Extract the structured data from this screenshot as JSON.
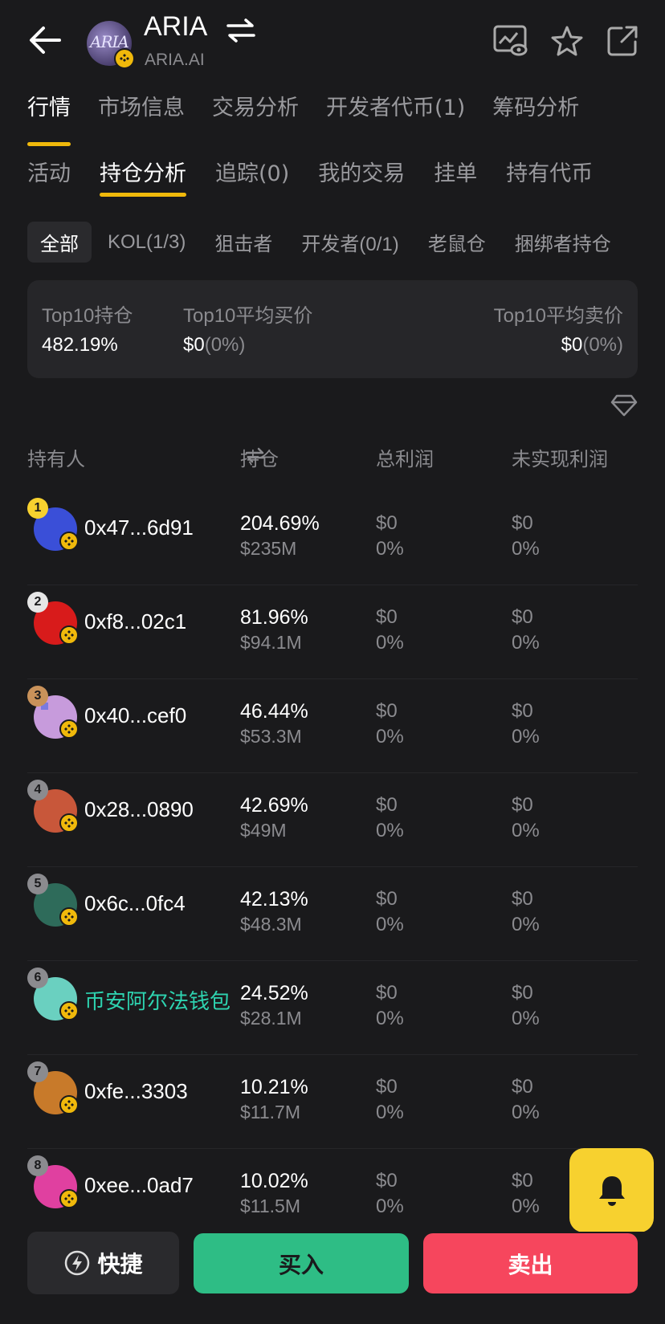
{
  "header": {
    "token_name": "ARIA",
    "token_sub": "ARIA.AI",
    "logo_text": "ARIA",
    "icons": [
      "back-arrow-icon",
      "swap-icon",
      "chart-watch-icon",
      "star-icon",
      "share-icon"
    ]
  },
  "main_tabs": [
    {
      "label": "行情",
      "active": true
    },
    {
      "label": "市场信息",
      "active": false
    },
    {
      "label": "交易分析",
      "active": false
    },
    {
      "label": "开发者代币(1)",
      "active": false
    },
    {
      "label": "筹码分析",
      "active": false
    }
  ],
  "sub_tabs": [
    {
      "label": "活动",
      "active": false
    },
    {
      "label": "持仓分析",
      "active": true
    },
    {
      "label": "追踪(0)",
      "active": false
    },
    {
      "label": "我的交易",
      "active": false
    },
    {
      "label": "挂单",
      "active": false
    },
    {
      "label": "持有代币",
      "active": false
    }
  ],
  "filters": [
    {
      "label": "全部",
      "active": true
    },
    {
      "label": "KOL(1/3)",
      "active": false
    },
    {
      "label": "狙击者",
      "active": false
    },
    {
      "label": "开发者(0/1)",
      "active": false
    },
    {
      "label": "老鼠仓",
      "active": false
    },
    {
      "label": "捆绑者持仓",
      "active": false
    }
  ],
  "summary": {
    "top10_holding_label": "Top10持仓",
    "top10_holding_value": "482.19%",
    "avg_buy_label": "Top10平均买价",
    "avg_buy_value": "$0",
    "avg_buy_pct": "(0%)",
    "avg_sell_label": "Top10平均卖价",
    "avg_sell_value": "$0",
    "avg_sell_pct": "(0%)"
  },
  "table": {
    "columns": [
      "持有人",
      "持仓",
      "总利润",
      "未实现利润"
    ],
    "rows": [
      {
        "rank": "1",
        "holder": "0x47...6d91",
        "hold_pct": "204.69%",
        "hold_usd": "$235M",
        "pnl": "$0",
        "pnl_pct": "0%",
        "upnl": "$0",
        "upnl_pct": "0%",
        "special": false
      },
      {
        "rank": "2",
        "holder": "0xf8...02c1",
        "hold_pct": "81.96%",
        "hold_usd": "$94.1M",
        "pnl": "$0",
        "pnl_pct": "0%",
        "upnl": "$0",
        "upnl_pct": "0%",
        "special": false
      },
      {
        "rank": "3",
        "holder": "0x40...cef0",
        "hold_pct": "46.44%",
        "hold_usd": "$53.3M",
        "pnl": "$0",
        "pnl_pct": "0%",
        "upnl": "$0",
        "upnl_pct": "0%",
        "special": false
      },
      {
        "rank": "4",
        "holder": "0x28...0890",
        "hold_pct": "42.69%",
        "hold_usd": "$49M",
        "pnl": "$0",
        "pnl_pct": "0%",
        "upnl": "$0",
        "upnl_pct": "0%",
        "special": false
      },
      {
        "rank": "5",
        "holder": "0x6c...0fc4",
        "hold_pct": "42.13%",
        "hold_usd": "$48.3M",
        "pnl": "$0",
        "pnl_pct": "0%",
        "upnl": "$0",
        "upnl_pct": "0%",
        "special": false
      },
      {
        "rank": "6",
        "holder": "币安阿尔法钱包",
        "hold_pct": "24.52%",
        "hold_usd": "$28.1M",
        "pnl": "$0",
        "pnl_pct": "0%",
        "upnl": "$0",
        "upnl_pct": "0%",
        "special": true
      },
      {
        "rank": "7",
        "holder": "0xfe...3303",
        "hold_pct": "10.21%",
        "hold_usd": "$11.7M",
        "pnl": "$0",
        "pnl_pct": "0%",
        "upnl": "$0",
        "upnl_pct": "0%",
        "special": false
      },
      {
        "rank": "8",
        "holder": "0xee...0ad7",
        "hold_pct": "10.02%",
        "hold_usd": "$11.5M",
        "pnl": "$0",
        "pnl_pct": "0%",
        "upnl": "$0",
        "upnl_pct": "0%",
        "special": false
      }
    ]
  },
  "bottom": {
    "quick_label": "快捷",
    "buy_label": "买入",
    "sell_label": "卖出"
  },
  "colors": {
    "background": "#1a1a1c",
    "accent": "#f0b90b",
    "buy": "#2ebd85",
    "sell": "#f6465d",
    "special_holder": "#2ed3b0",
    "bell": "#f7d12f"
  }
}
